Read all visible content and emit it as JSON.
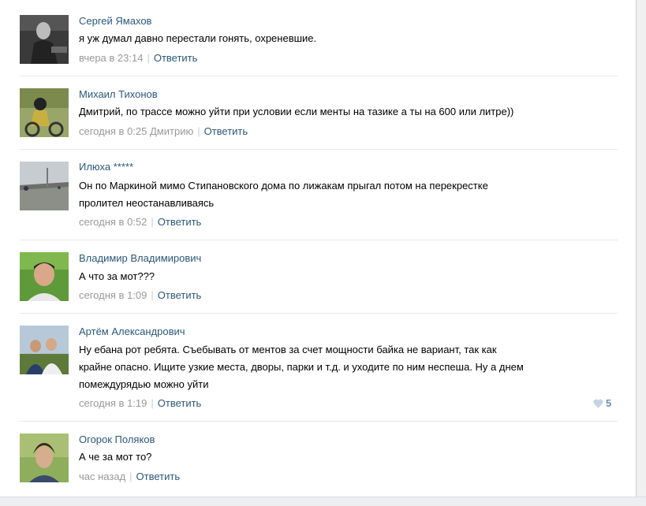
{
  "comments": [
    {
      "author": "Сергей Ямахов",
      "lines": [
        "я уж думал давно перестали гонять, охреневшие."
      ],
      "time": "вчера в 23:14",
      "reply_to": "",
      "reply_label": "Ответить"
    },
    {
      "author": "Михаил Тихонов",
      "lines": [
        "Дмитрий, по трассе можно уйти при условии если менты на тазике а ты на 600 или литре))"
      ],
      "time": "сегодня в 0:25",
      "reply_to": "Дмитрию",
      "reply_label": "Ответить"
    },
    {
      "author": "Илюха *****",
      "lines": [
        "Он по Маркиной мимо Стипановского дома по лижакам прыгал потом на перекрестке",
        "пролител неостанавливаясь"
      ],
      "time": "сегодня в 0:52",
      "reply_to": "",
      "reply_label": "Ответить"
    },
    {
      "author": "Владимир Владимирович",
      "lines": [
        "А что за мот???"
      ],
      "time": "сегодня в 1:09",
      "reply_to": "",
      "reply_label": "Ответить"
    },
    {
      "author": "Артём Александрович",
      "lines": [
        "Ну ебана рот ребята. Съебывать от ментов за счет мощности байка не вариант, так как",
        "крайне опасно. Ищите узкие места, дворы, парки и т.д. и уходите по ним неспеша. Ну а днем",
        "помеждурядью можно уйти"
      ],
      "time": "сегодня в 1:19",
      "reply_to": "",
      "reply_label": "Ответить",
      "likes": "5"
    },
    {
      "author": "Огорок Поляков",
      "lines": [
        "А че за мот то?"
      ],
      "time": "час назад",
      "reply_to": "",
      "reply_label": "Ответить"
    }
  ],
  "colors": {
    "link": "#2b587a",
    "meta": "#999999",
    "divider": "#e7e8ec",
    "like": "#6d8fb3"
  },
  "icons": {
    "like": "heart-icon"
  }
}
